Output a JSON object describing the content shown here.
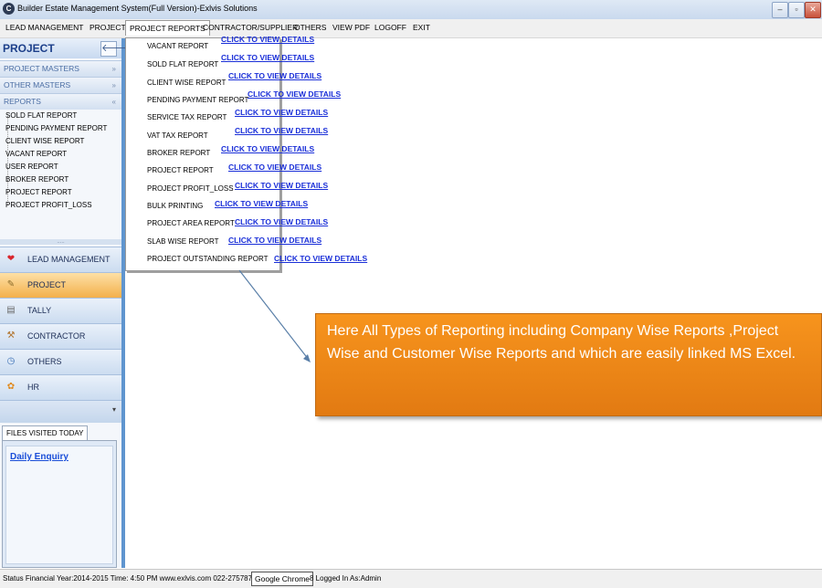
{
  "window": {
    "title": "Builder Estate Management System(Full Version)-Exlvis Solutions",
    "app_icon_char": "C",
    "controls": {
      "minimize": "–",
      "maximize": "▫",
      "close": "✕"
    }
  },
  "menu": {
    "items": [
      "LEAD MANAGEMENT",
      "PROJECT",
      "PROJECT REPORTS",
      "CONTRACTOR/SUPPLIER",
      "OTHERS",
      "VIEW PDF",
      "LOGOFF",
      "EXIT"
    ],
    "active": "PROJECT REPORTS"
  },
  "dropdown": {
    "link_text": "CLICK TO VIEW DETAILS",
    "reports": [
      "VACANT REPORT",
      "SOLD FLAT REPORT",
      "CLIENT WISE REPORT",
      "PENDING PAYMENT REPORT",
      "SERVICE TAX REPORT",
      "VAT TAX REPORT",
      "BROKER REPORT",
      "PROJECT REPORT",
      "PROJECT PROFIT_LOSS",
      "BULK PRINTING",
      "PROJECT AREA REPORT",
      "SLAB WISE REPORT",
      "PROJECT OUTSTANDING REPORT"
    ]
  },
  "sidebar": {
    "title": "PROJECT",
    "collapse_icon": "🡐",
    "groups": [
      {
        "label": "PROJECT MASTERS",
        "chevron": "»"
      },
      {
        "label": "OTHER MASTERS",
        "chevron": "»"
      },
      {
        "label": "REPORTS",
        "chevron": "«"
      }
    ],
    "tree_items": [
      "SOLD FLAT REPORT",
      "PENDING PAYMENT REPORT",
      "CLIENT WISE REPORT",
      "VACANT REPORT",
      "USER REPORT",
      "BROKER REPORT",
      "PROJECT REPORT",
      "PROJECT PROFIT_LOSS"
    ],
    "splitter": ".....",
    "nav": [
      {
        "label": "LEAD MANAGEMENT",
        "icon": "❤",
        "icon_name": "heart-icon",
        "color": "#d9262c"
      },
      {
        "label": "PROJECT",
        "icon": "✎",
        "icon_name": "pencil-icon",
        "color": "#8a6b2a"
      },
      {
        "label": "TALLY",
        "icon": "▤",
        "icon_name": "document-icon",
        "color": "#6b6b6b"
      },
      {
        "label": "CONTRACTOR",
        "icon": "⚒",
        "icon_name": "tools-icon",
        "color": "#b0732b"
      },
      {
        "label": "OTHERS",
        "icon": "◷",
        "icon_name": "clock-icon",
        "color": "#3a6fb5"
      },
      {
        "label": "HR",
        "icon": "✿",
        "icon_name": "flower-icon",
        "color": "#e08a1e"
      }
    ],
    "nav_active": "PROJECT",
    "more_chevron": "▾",
    "files_tab": "FILES VISITED TODAY",
    "files_links": [
      "Daily Enquiry"
    ]
  },
  "callout": {
    "text": "Here All Types of Reporting including Company Wise Reports ,Project Wise and Customer Wise Reports and which are easily linked MS Excel.",
    "color": "#f7941d"
  },
  "status": {
    "text": "Status  Financial Year:2014-2015  Time:  4:50 PM  www.exlvis.com  022-275787",
    "tooltip": "Google Chrome",
    "tail": "8  Logged In As:Admin"
  }
}
